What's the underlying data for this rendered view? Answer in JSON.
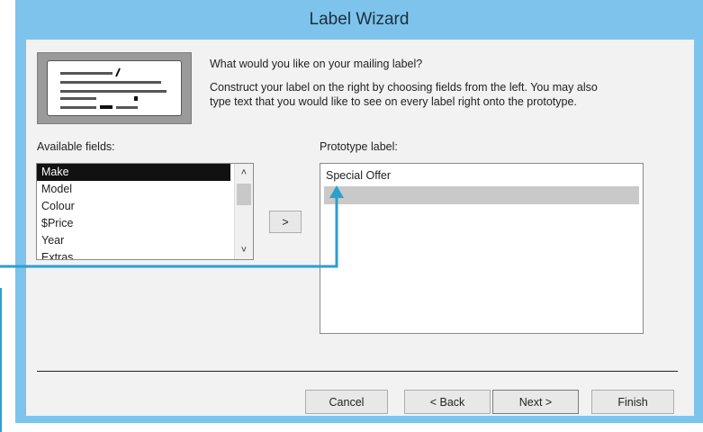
{
  "window": {
    "title": "Label Wizard"
  },
  "header": {
    "question": "What would you like on your mailing label?",
    "instructions_line1": "Construct your label on the right by choosing fields from the left. You may also",
    "instructions_line2": "type text that you would like to see on every label right onto the prototype."
  },
  "available_fields": {
    "label": "Available fields:",
    "items": [
      "Make",
      "Model",
      "Colour",
      "$Price",
      "Year",
      "Extras"
    ],
    "selected": "Make"
  },
  "add_button": {
    "label": ">"
  },
  "prototype": {
    "label": "Prototype label:",
    "lines": [
      "Special Offer",
      ""
    ]
  },
  "footer": {
    "cancel": "Cancel",
    "back": "< Back",
    "next": "Next >",
    "finish": "Finish"
  },
  "colors": {
    "title_bar": "#7ec3eb",
    "callout": "#2a9fd0",
    "selection": "#111111"
  },
  "icons": [
    "label-thumbnail-icon",
    "chevron-up-icon",
    "chevron-down-icon",
    "callout-arrow"
  ]
}
